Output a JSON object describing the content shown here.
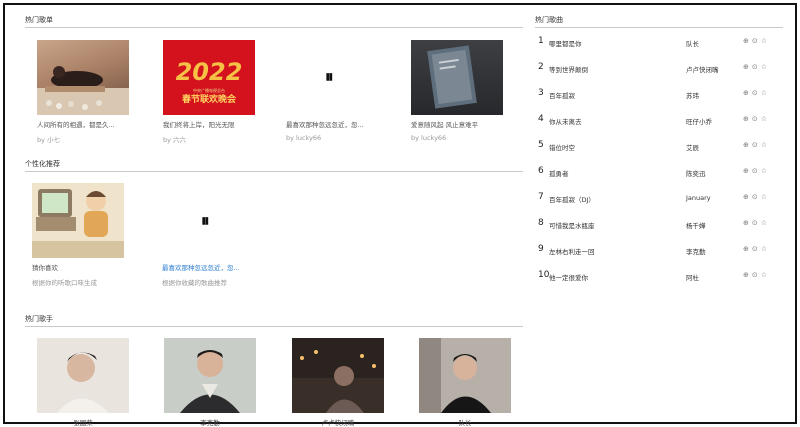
{
  "sections": {
    "hot_playlists": "热门歌单",
    "personalized": "个性化推荐",
    "hot_singers": "热门歌手",
    "hot_songs": "热门歌曲"
  },
  "playlists": [
    {
      "title": "人间所有的相遇，都是久...",
      "by": "by 小七"
    },
    {
      "title": "我们终将上岸，阳光无限",
      "by": "by 六六"
    },
    {
      "title": "最喜欢那种忽远忽近，忽...",
      "by": "by lucky66"
    },
    {
      "title": "爱意随风起 风止意难平",
      "by": "by lucky66"
    }
  ],
  "gala_cover": {
    "line1": "中央广播电视总台",
    "line2": "春节联欢晚会",
    "year": "2022"
  },
  "pause_glyph": "⏸",
  "recommend": [
    {
      "title": "猜你喜欢",
      "sub": "根据你的听歌口味生成"
    },
    {
      "title": "最喜欢那种忽远忽近，忽...",
      "sub": "根据你收藏的歌曲推荐"
    }
  ],
  "singers": [
    {
      "name": "张国荣"
    },
    {
      "name": "李克勤"
    },
    {
      "name": "卢卢快闭嘴"
    },
    {
      "name": "队长"
    }
  ],
  "songs": [
    {
      "rank": "1",
      "name": "哪里都是你",
      "artist": "队长"
    },
    {
      "rank": "2",
      "name": "等到世界颠倒",
      "artist": "卢卢快闭嘴"
    },
    {
      "rank": "3",
      "name": "百年孤寂",
      "artist": "苏玮"
    },
    {
      "rank": "4",
      "name": "你从未离去",
      "artist": "旺仔小乔"
    },
    {
      "rank": "5",
      "name": "错位时空",
      "artist": "艾辰"
    },
    {
      "rank": "6",
      "name": "孤勇者",
      "artist": "陈奕迅"
    },
    {
      "rank": "7",
      "name": "百年孤寂（DJ）",
      "artist": "January"
    },
    {
      "rank": "8",
      "name": "可惜我是水瓶座",
      "artist": "杨千嬅"
    },
    {
      "rank": "9",
      "name": "左林右利走一回",
      "artist": "李克勤"
    },
    {
      "rank": "10",
      "name": "他一定很爱你",
      "artist": "阿杜"
    }
  ],
  "song_actions": {
    "play": "⊕",
    "add": "⊙",
    "fav": "☆"
  }
}
